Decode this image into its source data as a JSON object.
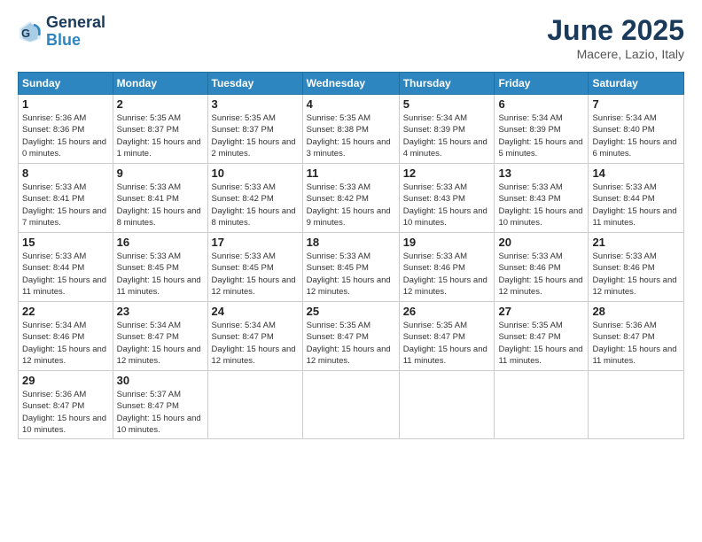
{
  "header": {
    "logo_line1": "General",
    "logo_line2": "Blue",
    "month": "June 2025",
    "location": "Macere, Lazio, Italy"
  },
  "weekdays": [
    "Sunday",
    "Monday",
    "Tuesday",
    "Wednesday",
    "Thursday",
    "Friday",
    "Saturday"
  ],
  "weeks": [
    [
      {
        "day": "1",
        "sunrise": "Sunrise: 5:36 AM",
        "sunset": "Sunset: 8:36 PM",
        "daylight": "Daylight: 15 hours and 0 minutes."
      },
      {
        "day": "2",
        "sunrise": "Sunrise: 5:35 AM",
        "sunset": "Sunset: 8:37 PM",
        "daylight": "Daylight: 15 hours and 1 minute."
      },
      {
        "day": "3",
        "sunrise": "Sunrise: 5:35 AM",
        "sunset": "Sunset: 8:37 PM",
        "daylight": "Daylight: 15 hours and 2 minutes."
      },
      {
        "day": "4",
        "sunrise": "Sunrise: 5:35 AM",
        "sunset": "Sunset: 8:38 PM",
        "daylight": "Daylight: 15 hours and 3 minutes."
      },
      {
        "day": "5",
        "sunrise": "Sunrise: 5:34 AM",
        "sunset": "Sunset: 8:39 PM",
        "daylight": "Daylight: 15 hours and 4 minutes."
      },
      {
        "day": "6",
        "sunrise": "Sunrise: 5:34 AM",
        "sunset": "Sunset: 8:39 PM",
        "daylight": "Daylight: 15 hours and 5 minutes."
      },
      {
        "day": "7",
        "sunrise": "Sunrise: 5:34 AM",
        "sunset": "Sunset: 8:40 PM",
        "daylight": "Daylight: 15 hours and 6 minutes."
      }
    ],
    [
      {
        "day": "8",
        "sunrise": "Sunrise: 5:33 AM",
        "sunset": "Sunset: 8:41 PM",
        "daylight": "Daylight: 15 hours and 7 minutes."
      },
      {
        "day": "9",
        "sunrise": "Sunrise: 5:33 AM",
        "sunset": "Sunset: 8:41 PM",
        "daylight": "Daylight: 15 hours and 8 minutes."
      },
      {
        "day": "10",
        "sunrise": "Sunrise: 5:33 AM",
        "sunset": "Sunset: 8:42 PM",
        "daylight": "Daylight: 15 hours and 8 minutes."
      },
      {
        "day": "11",
        "sunrise": "Sunrise: 5:33 AM",
        "sunset": "Sunset: 8:42 PM",
        "daylight": "Daylight: 15 hours and 9 minutes."
      },
      {
        "day": "12",
        "sunrise": "Sunrise: 5:33 AM",
        "sunset": "Sunset: 8:43 PM",
        "daylight": "Daylight: 15 hours and 10 minutes."
      },
      {
        "day": "13",
        "sunrise": "Sunrise: 5:33 AM",
        "sunset": "Sunset: 8:43 PM",
        "daylight": "Daylight: 15 hours and 10 minutes."
      },
      {
        "day": "14",
        "sunrise": "Sunrise: 5:33 AM",
        "sunset": "Sunset: 8:44 PM",
        "daylight": "Daylight: 15 hours and 11 minutes."
      }
    ],
    [
      {
        "day": "15",
        "sunrise": "Sunrise: 5:33 AM",
        "sunset": "Sunset: 8:44 PM",
        "daylight": "Daylight: 15 hours and 11 minutes."
      },
      {
        "day": "16",
        "sunrise": "Sunrise: 5:33 AM",
        "sunset": "Sunset: 8:45 PM",
        "daylight": "Daylight: 15 hours and 11 minutes."
      },
      {
        "day": "17",
        "sunrise": "Sunrise: 5:33 AM",
        "sunset": "Sunset: 8:45 PM",
        "daylight": "Daylight: 15 hours and 12 minutes."
      },
      {
        "day": "18",
        "sunrise": "Sunrise: 5:33 AM",
        "sunset": "Sunset: 8:45 PM",
        "daylight": "Daylight: 15 hours and 12 minutes."
      },
      {
        "day": "19",
        "sunrise": "Sunrise: 5:33 AM",
        "sunset": "Sunset: 8:46 PM",
        "daylight": "Daylight: 15 hours and 12 minutes."
      },
      {
        "day": "20",
        "sunrise": "Sunrise: 5:33 AM",
        "sunset": "Sunset: 8:46 PM",
        "daylight": "Daylight: 15 hours and 12 minutes."
      },
      {
        "day": "21",
        "sunrise": "Sunrise: 5:33 AM",
        "sunset": "Sunset: 8:46 PM",
        "daylight": "Daylight: 15 hours and 12 minutes."
      }
    ],
    [
      {
        "day": "22",
        "sunrise": "Sunrise: 5:34 AM",
        "sunset": "Sunset: 8:46 PM",
        "daylight": "Daylight: 15 hours and 12 minutes."
      },
      {
        "day": "23",
        "sunrise": "Sunrise: 5:34 AM",
        "sunset": "Sunset: 8:47 PM",
        "daylight": "Daylight: 15 hours and 12 minutes."
      },
      {
        "day": "24",
        "sunrise": "Sunrise: 5:34 AM",
        "sunset": "Sunset: 8:47 PM",
        "daylight": "Daylight: 15 hours and 12 minutes."
      },
      {
        "day": "25",
        "sunrise": "Sunrise: 5:35 AM",
        "sunset": "Sunset: 8:47 PM",
        "daylight": "Daylight: 15 hours and 12 minutes."
      },
      {
        "day": "26",
        "sunrise": "Sunrise: 5:35 AM",
        "sunset": "Sunset: 8:47 PM",
        "daylight": "Daylight: 15 hours and 11 minutes."
      },
      {
        "day": "27",
        "sunrise": "Sunrise: 5:35 AM",
        "sunset": "Sunset: 8:47 PM",
        "daylight": "Daylight: 15 hours and 11 minutes."
      },
      {
        "day": "28",
        "sunrise": "Sunrise: 5:36 AM",
        "sunset": "Sunset: 8:47 PM",
        "daylight": "Daylight: 15 hours and 11 minutes."
      }
    ],
    [
      {
        "day": "29",
        "sunrise": "Sunrise: 5:36 AM",
        "sunset": "Sunset: 8:47 PM",
        "daylight": "Daylight: 15 hours and 10 minutes."
      },
      {
        "day": "30",
        "sunrise": "Sunrise: 5:37 AM",
        "sunset": "Sunset: 8:47 PM",
        "daylight": "Daylight: 15 hours and 10 minutes."
      },
      null,
      null,
      null,
      null,
      null
    ]
  ]
}
